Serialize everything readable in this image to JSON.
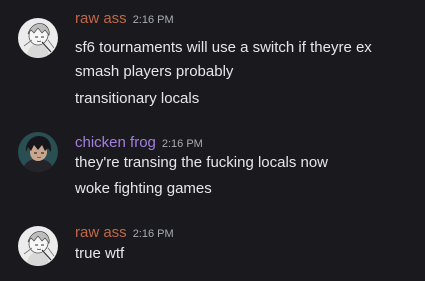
{
  "colors": {
    "background": "#1a1a1e",
    "message_text": "#e6e7ea",
    "timestamp": "#a9abb3",
    "raw_ass_name": "#c0664a",
    "chicken_frog_name": "#a47ee0"
  },
  "messages": [
    {
      "author": "raw ass",
      "time": "2:16 PM",
      "avatar_icon": "anime-character-sketch-avatar",
      "lines": [
        "sf6 tournaments will use a switch if theyre ex",
        "smash players probably",
        "transitionary locals"
      ]
    },
    {
      "author": "chicken frog",
      "time": "2:16 PM",
      "avatar_icon": "dark-haired-character-avatar",
      "lines": [
        "they're transing the fucking locals now",
        "woke fighting games"
      ]
    },
    {
      "author": "raw ass",
      "time": "2:16 PM",
      "avatar_icon": "anime-character-sketch-avatar",
      "lines": [
        "true wtf"
      ]
    }
  ]
}
